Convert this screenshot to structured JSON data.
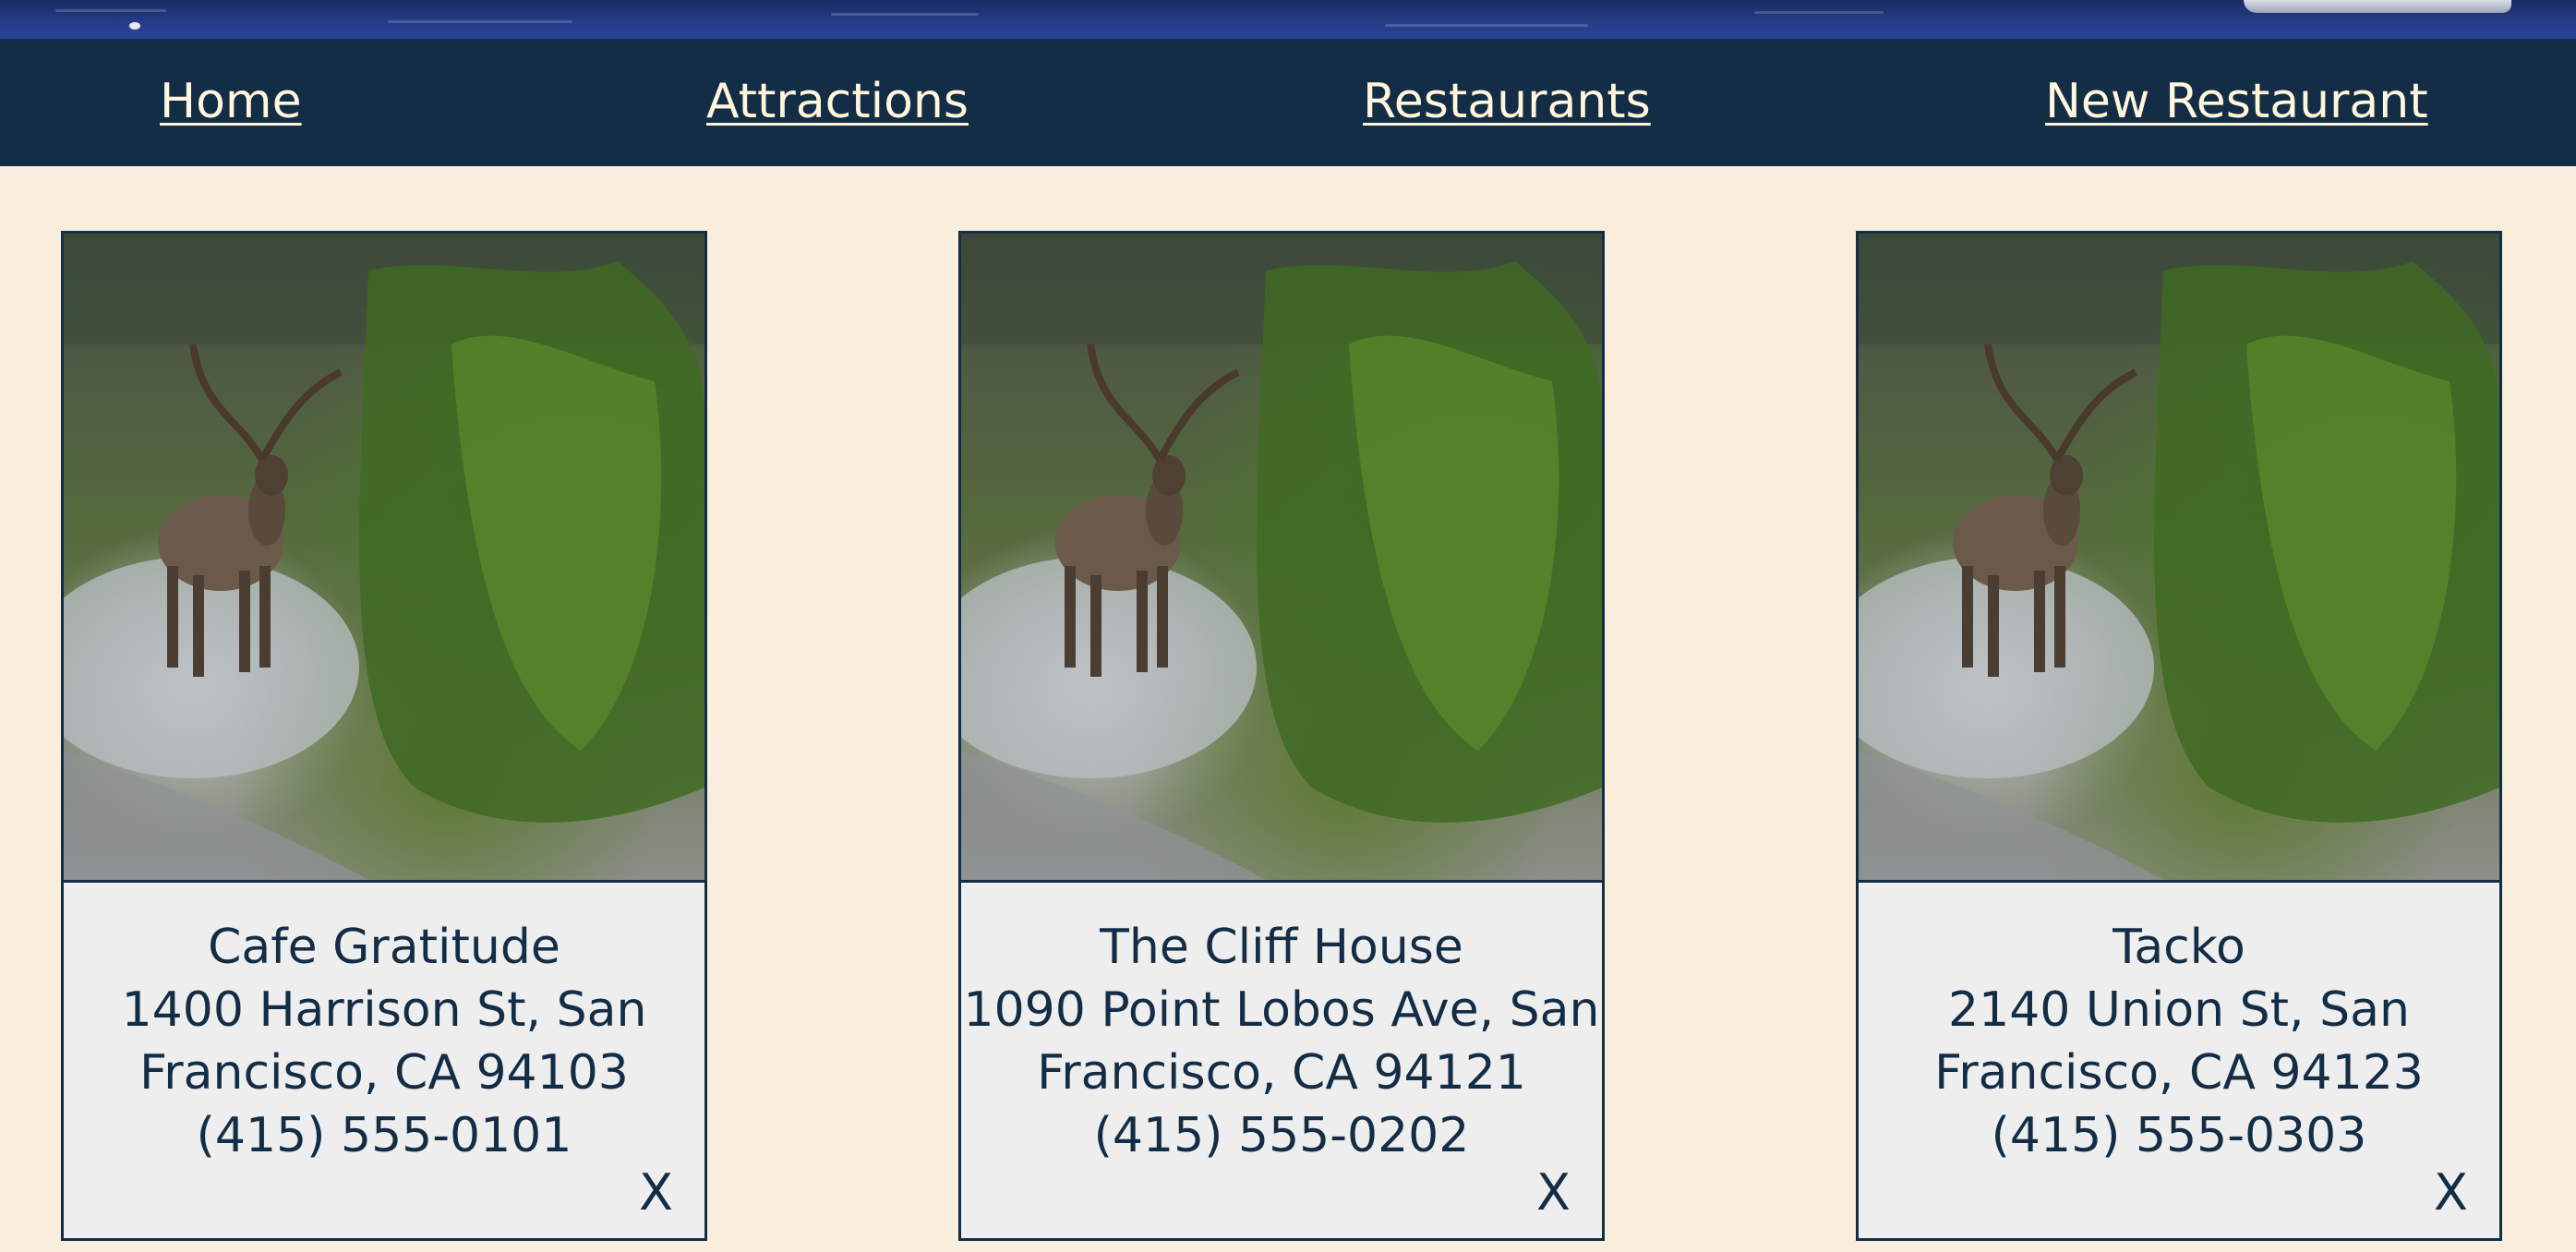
{
  "nav": {
    "home": "Home",
    "attractions": "Attractions",
    "restaurants": "Restaurants",
    "new_restaurant": "New Restaurant"
  },
  "colors": {
    "page_background": "#f8eedb",
    "navbar": "#142d46",
    "nav_text": "#fff6dc",
    "card_text": "#142d46",
    "card_background": "#eeeeee"
  },
  "cards": [
    {
      "name": "Cafe Gratitude",
      "address_line1": "1400 Harrison St, San",
      "address_line2": "Francisco, CA 94103",
      "phone": "(415) 555-0101",
      "delete_label": "X",
      "image_icon": "deer-photo"
    },
    {
      "name": "The Cliff House",
      "address_line1": "1090 Point Lobos Ave, San",
      "address_line2": "Francisco, CA 94121",
      "phone": "(415) 555-0202",
      "delete_label": "X",
      "image_icon": "deer-photo"
    },
    {
      "name": "Tacko",
      "address_line1": "2140 Union St, San",
      "address_line2": "Francisco, CA 94123",
      "phone": "(415) 555-0303",
      "delete_label": "X",
      "image_icon": "deer-photo"
    }
  ]
}
